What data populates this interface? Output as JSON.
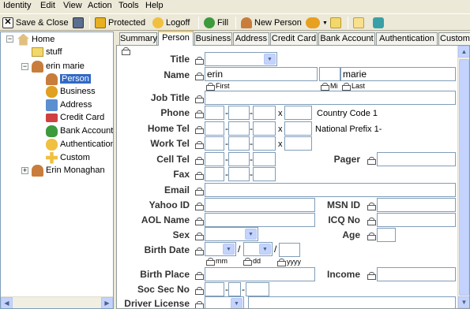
{
  "menu": [
    "Identity",
    "Edit",
    "View",
    "Action",
    "Tools",
    "Help"
  ],
  "toolbar": {
    "save_close": "Save & Close",
    "protected": "Protected",
    "logoff": "Logoff",
    "fill": "Fill",
    "new_person": "New Person"
  },
  "tree": {
    "home": "Home",
    "stuff": "stuff",
    "erin_marie": "erin marie",
    "person": "Person",
    "business": "Business",
    "address": "Address",
    "credit_card": "Credit Card",
    "bank_account": "Bank Account",
    "authentication": "Authentication",
    "custom": "Custom",
    "erin_monaghan": "Erin Monaghan"
  },
  "tabs": [
    "Summary",
    "Person",
    "Business",
    "Address",
    "Credit Card",
    "Bank Account",
    "Authentication",
    "Custom"
  ],
  "form": {
    "title_label": "Title",
    "name_label": "Name",
    "first_value": "erin",
    "last_value": "marie",
    "first_sub": "First",
    "mi_sub": "Mi",
    "last_sub": "Last",
    "job_title_label": "Job Title",
    "phone_label": "Phone",
    "x": "x",
    "country_code": "Country Code 1",
    "home_tel_label": "Home Tel",
    "national_prefix": "National Prefix 1-",
    "work_tel_label": "Work Tel",
    "cell_tel_label": "Cell Tel",
    "pager_label": "Pager",
    "fax_label": "Fax",
    "email_label": "Email",
    "yahoo_label": "Yahoo ID",
    "msn_label": "MSN ID",
    "aol_label": "AOL Name",
    "icq_label": "ICQ No",
    "sex_label": "Sex",
    "age_label": "Age",
    "birth_date_label": "Birth Date",
    "slash": "/",
    "mm_sub": "mm",
    "dd_sub": "dd",
    "yyyy_sub": "yyyy",
    "birth_place_label": "Birth Place",
    "income_label": "Income",
    "soc_sec_label": "Soc Sec No",
    "driver_license_label": "Driver License"
  }
}
